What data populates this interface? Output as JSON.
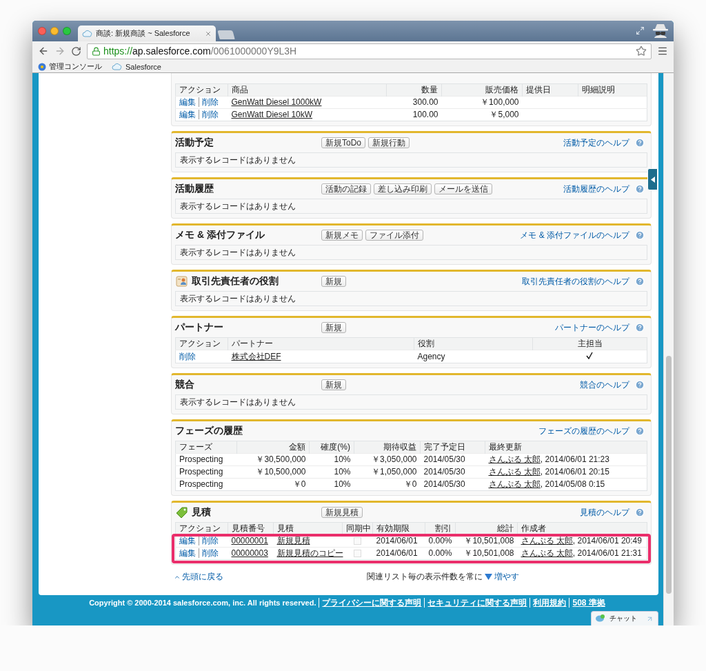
{
  "browser": {
    "tab_title": "商談: 新規商談 ~ Salesforce",
    "url_scheme": "https://",
    "url_host": "ap.salesforce.com",
    "url_path": "/0061000000Y9L3H",
    "bookmarks": [
      "管理コンソール",
      "Salesforce"
    ]
  },
  "related_lists": [
    {
      "kind": "table",
      "columns": [
        {
          "label": "アクション"
        },
        {
          "label": "商品"
        },
        {
          "label": "数量"
        },
        {
          "label": "販売価格"
        },
        {
          "label": "提供日"
        },
        {
          "label": "明細説明"
        }
      ],
      "rows": [
        [
          {
            "kind": "actions",
            "links": [
              "編集",
              "削除"
            ]
          },
          {
            "kind": "link",
            "text": "GenWatt Diesel 1000kW"
          },
          {
            "kind": "text",
            "text": "300.00"
          },
          {
            "kind": "text",
            "text": "￥100,000"
          },
          {
            "kind": "text",
            "text": ""
          },
          {
            "kind": "text",
            "text": ""
          }
        ],
        [
          {
            "kind": "actions",
            "links": [
              "編集",
              "削除"
            ]
          },
          {
            "kind": "link",
            "text": "GenWatt Diesel 10kW"
          },
          {
            "kind": "text",
            "text": "100.00"
          },
          {
            "kind": "text",
            "text": "￥5,000"
          },
          {
            "kind": "text",
            "text": ""
          },
          {
            "kind": "text",
            "text": ""
          }
        ]
      ]
    },
    {
      "kind": "empty",
      "title": "活動予定",
      "buttons": [
        "新規ToDo",
        "新規行動"
      ],
      "help": "活動予定のヘルプ",
      "empty_text": "表示するレコードはありません"
    },
    {
      "kind": "empty",
      "title": "活動履歴",
      "buttons": [
        "活動の記録",
        "差し込み印刷",
        "メールを送信"
      ],
      "help": "活動履歴のヘルプ",
      "empty_text": "表示するレコードはありません"
    },
    {
      "kind": "empty",
      "title": "メモ & 添付ファイル",
      "buttons": [
        "新規メモ",
        "ファイル添付"
      ],
      "help": "メモ & 添付ファイルのヘルプ",
      "empty_text": "表示するレコードはありません"
    },
    {
      "kind": "empty",
      "title": "取引先責任者の役割",
      "buttons": [
        "新規"
      ],
      "help": "取引先責任者の役割のヘルプ",
      "empty_text": "表示するレコードはありません"
    },
    {
      "kind": "table",
      "title": "パートナー",
      "buttons": [
        "新規"
      ],
      "help": "パートナーのヘルプ",
      "columns": [
        {
          "label": "アクション"
        },
        {
          "label": "パートナー"
        },
        {
          "label": "役割"
        },
        {
          "label": "主担当"
        }
      ],
      "rows": [
        [
          {
            "kind": "actions",
            "links": [
              "削除"
            ]
          },
          {
            "kind": "link",
            "text": "株式会社DEF"
          },
          {
            "kind": "text",
            "text": "Agency"
          },
          {
            "kind": "check",
            "checked": true
          }
        ]
      ]
    },
    {
      "kind": "empty",
      "title": "競合",
      "buttons": [
        "新規"
      ],
      "help": "競合のヘルプ",
      "empty_text": "表示するレコードはありません"
    },
    {
      "kind": "table",
      "title": "フェーズの履歴",
      "help": "フェーズの履歴のヘルプ",
      "columns": [
        {
          "label": "フェーズ"
        },
        {
          "label": "金額"
        },
        {
          "label": "確度(%)"
        },
        {
          "label": "期待収益"
        },
        {
          "label": "完了予定日"
        },
        {
          "label": "最終更新"
        }
      ],
      "rows": [
        [
          {
            "kind": "text",
            "text": "Prospecting"
          },
          {
            "kind": "text",
            "text": "￥30,500,000"
          },
          {
            "kind": "text",
            "text": "10%"
          },
          {
            "kind": "text",
            "text": "￥3,050,000"
          },
          {
            "kind": "text",
            "text": "2014/05/30"
          },
          {
            "kind": "user",
            "link": "さんぷる 太郎",
            "text": ", 2014/06/01 21:23"
          }
        ],
        [
          {
            "kind": "text",
            "text": "Prospecting"
          },
          {
            "kind": "text",
            "text": "￥10,500,000"
          },
          {
            "kind": "text",
            "text": "10%"
          },
          {
            "kind": "text",
            "text": "￥1,050,000"
          },
          {
            "kind": "text",
            "text": "2014/05/30"
          },
          {
            "kind": "user",
            "link": "さんぷる 太郎",
            "text": ", 2014/06/01 20:15"
          }
        ],
        [
          {
            "kind": "text",
            "text": "Prospecting"
          },
          {
            "kind": "text",
            "text": "￥0"
          },
          {
            "kind": "text",
            "text": "10%"
          },
          {
            "kind": "text",
            "text": "￥0"
          },
          {
            "kind": "text",
            "text": "2014/05/30"
          },
          {
            "kind": "user",
            "link": "さんぷる 太郎",
            "text": ", 2014/05/08 0:15"
          }
        ]
      ]
    },
    {
      "kind": "table",
      "title": "見積",
      "highlighted": true,
      "buttons": [
        "新規見積"
      ],
      "help": "見積のヘルプ",
      "columns": [
        {
          "label": "アクション"
        },
        {
          "label": "見積番号"
        },
        {
          "label": "見積"
        },
        {
          "label": "同期中"
        },
        {
          "label": "有効期限"
        },
        {
          "label": "割引"
        },
        {
          "label": "総計"
        },
        {
          "label": "作成者"
        }
      ],
      "rows": [
        [
          {
            "kind": "actions",
            "links": [
              "編集",
              "削除"
            ]
          },
          {
            "kind": "link",
            "text": "00000001"
          },
          {
            "kind": "link",
            "text": "新規見積"
          },
          {
            "kind": "checkbox",
            "checked": false
          },
          {
            "kind": "text",
            "text": "2014/06/01"
          },
          {
            "kind": "text",
            "text": "0.00%"
          },
          {
            "kind": "text",
            "text": "￥10,501,008"
          },
          {
            "kind": "user",
            "link": "さんぷる 太郎",
            "text": ", 2014/06/01 20:49"
          }
        ],
        [
          {
            "kind": "actions",
            "links": [
              "編集",
              "削除"
            ]
          },
          {
            "kind": "link",
            "text": "00000003"
          },
          {
            "kind": "link",
            "text": "新規見積のコピー"
          },
          {
            "kind": "checkbox",
            "checked": false
          },
          {
            "kind": "text",
            "text": "2014/06/01"
          },
          {
            "kind": "text",
            "text": "0.00%"
          },
          {
            "kind": "text",
            "text": "￥10,501,008"
          },
          {
            "kind": "user",
            "link": "さんぷる 太郎",
            "text": ", 2014/06/01 21:31"
          }
        ]
      ]
    }
  ],
  "page_footer": {
    "back_to_top": "先頭に戻る",
    "show_more_text": "関連リスト毎の表示件数を常に",
    "show_more_link": "増やす"
  },
  "site_footer": {
    "copyright": "Copyright © 2000-2014 salesforce.com, inc. All rights reserved.",
    "links": [
      "プライバシーに関する声明",
      "セキュリティに関する声明",
      "利用規約",
      "508 準拠"
    ]
  },
  "chat": {
    "label": "チャット"
  }
}
